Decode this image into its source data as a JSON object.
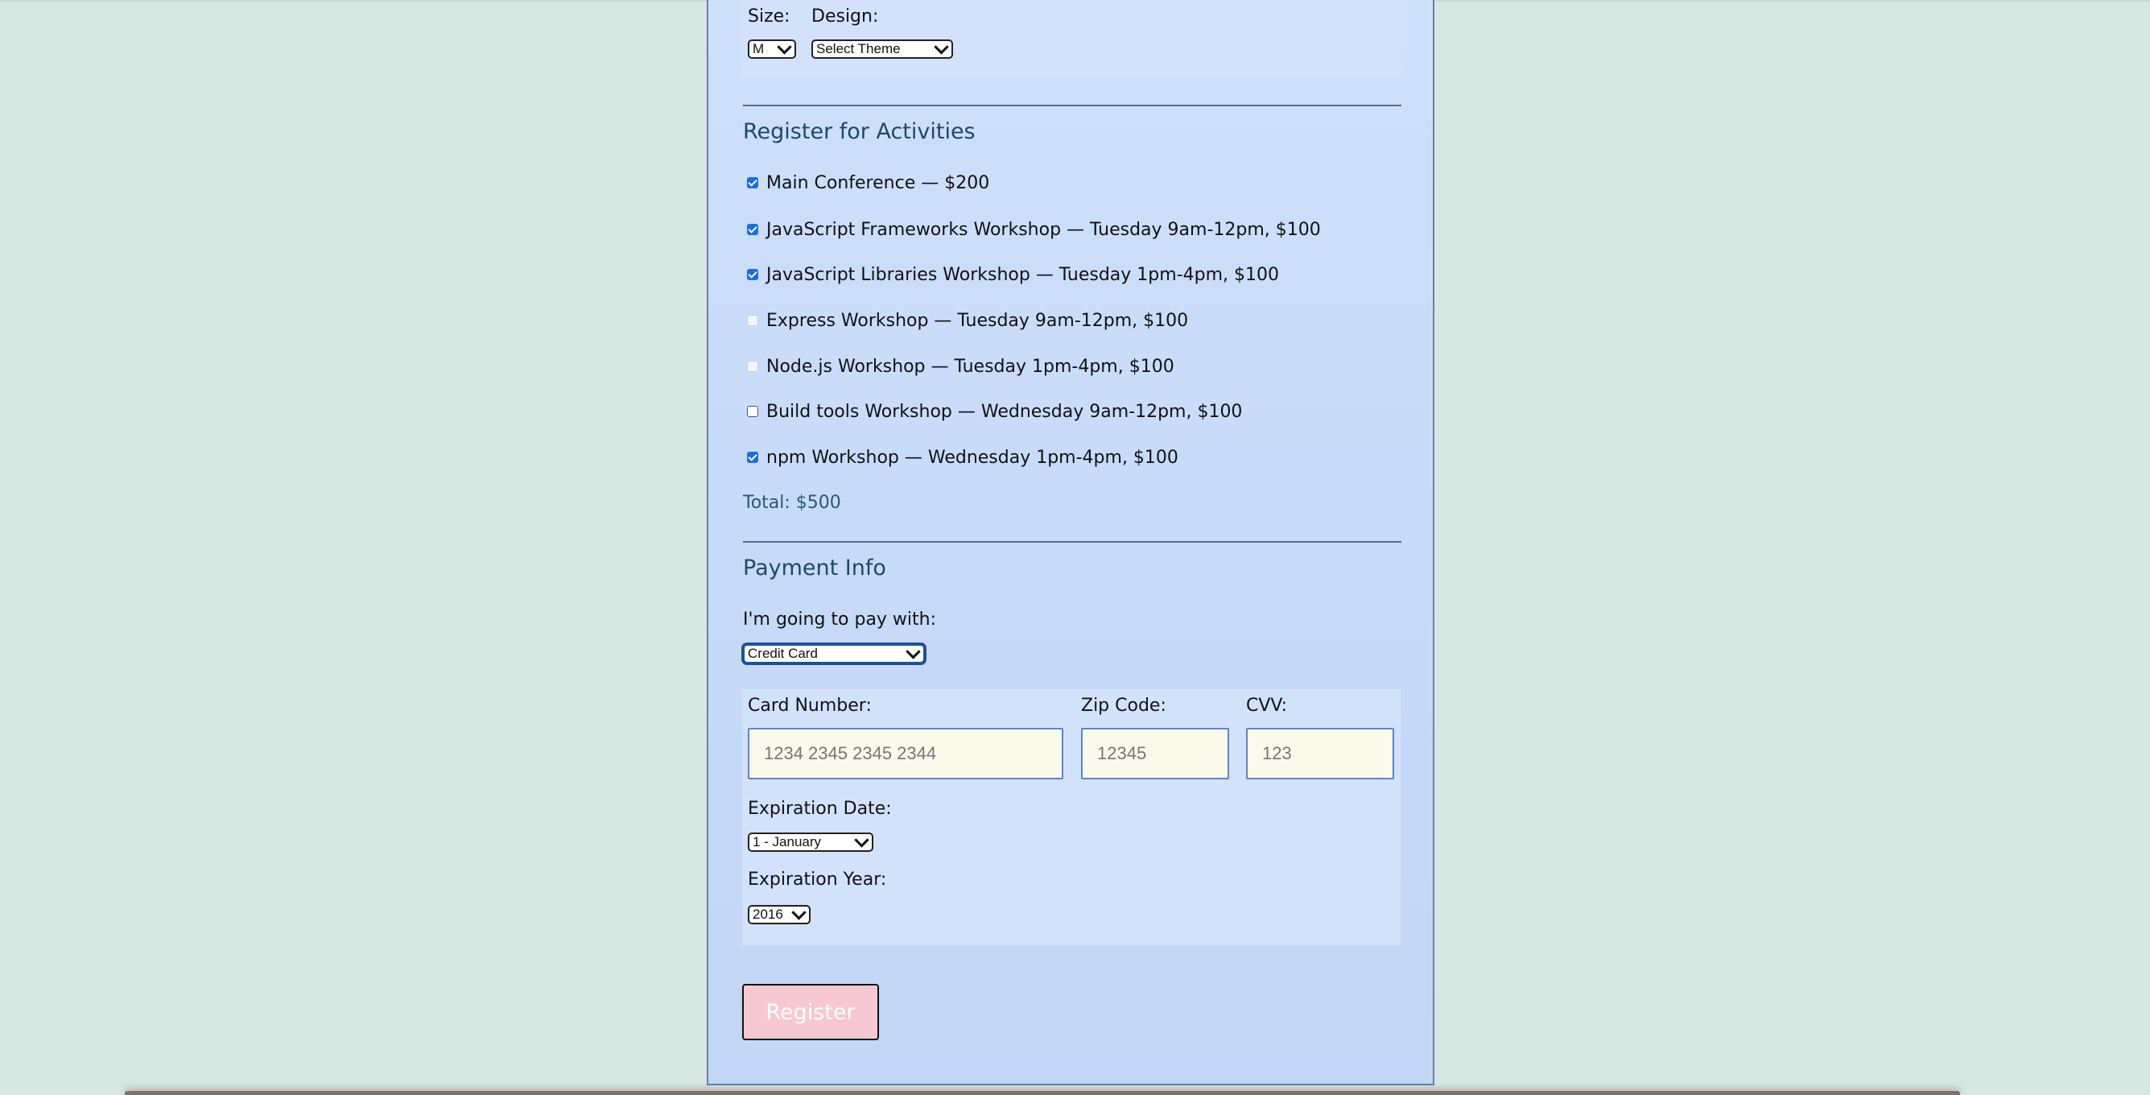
{
  "tshirt": {
    "size_label": "Size:",
    "size_value": "M",
    "design_label": "Design:",
    "design_value": "Select Theme"
  },
  "activities": {
    "title": "Register for Activities",
    "items": [
      {
        "label": "Main Conference — $200",
        "checked": true,
        "disabled": false
      },
      {
        "label": "JavaScript Frameworks Workshop — Tuesday 9am-12pm, $100",
        "checked": true,
        "disabled": false
      },
      {
        "label": "JavaScript Libraries Workshop — Tuesday 1pm-4pm, $100",
        "checked": true,
        "disabled": false
      },
      {
        "label": "Express Workshop — Tuesday 9am-12pm, $100",
        "checked": false,
        "disabled": true
      },
      {
        "label": "Node.js Workshop — Tuesday 1pm-4pm, $100",
        "checked": false,
        "disabled": true
      },
      {
        "label": "Build tools Workshop — Wednesday 9am-12pm, $100",
        "checked": false,
        "disabled": false
      },
      {
        "label": "npm Workshop — Wednesday 1pm-4pm, $100",
        "checked": true,
        "disabled": false
      }
    ],
    "total": "Total: $500"
  },
  "payment": {
    "title": "Payment Info",
    "method_label": "I'm going to pay with:",
    "method_value": "Credit Card",
    "card_number_label": "Card Number:",
    "card_number_placeholder": "1234 2345 2345 2344",
    "zip_label": "Zip Code:",
    "zip_placeholder": "12345",
    "cvv_label": "CVV:",
    "cvv_placeholder": "123",
    "exp_date_label": "Expiration Date:",
    "exp_date_value": "1 - January",
    "exp_year_label": "Expiration Year:",
    "exp_year_value": "2016"
  },
  "register_label": "Register",
  "colors": {
    "page_background": "#d8e6e1",
    "panel_background": "#c8dafa",
    "section_title": "#204a5f",
    "register_button": "#f6c9d2",
    "input_background": "#fbf8ec",
    "checkbox_checked": "#1a6fe0"
  }
}
